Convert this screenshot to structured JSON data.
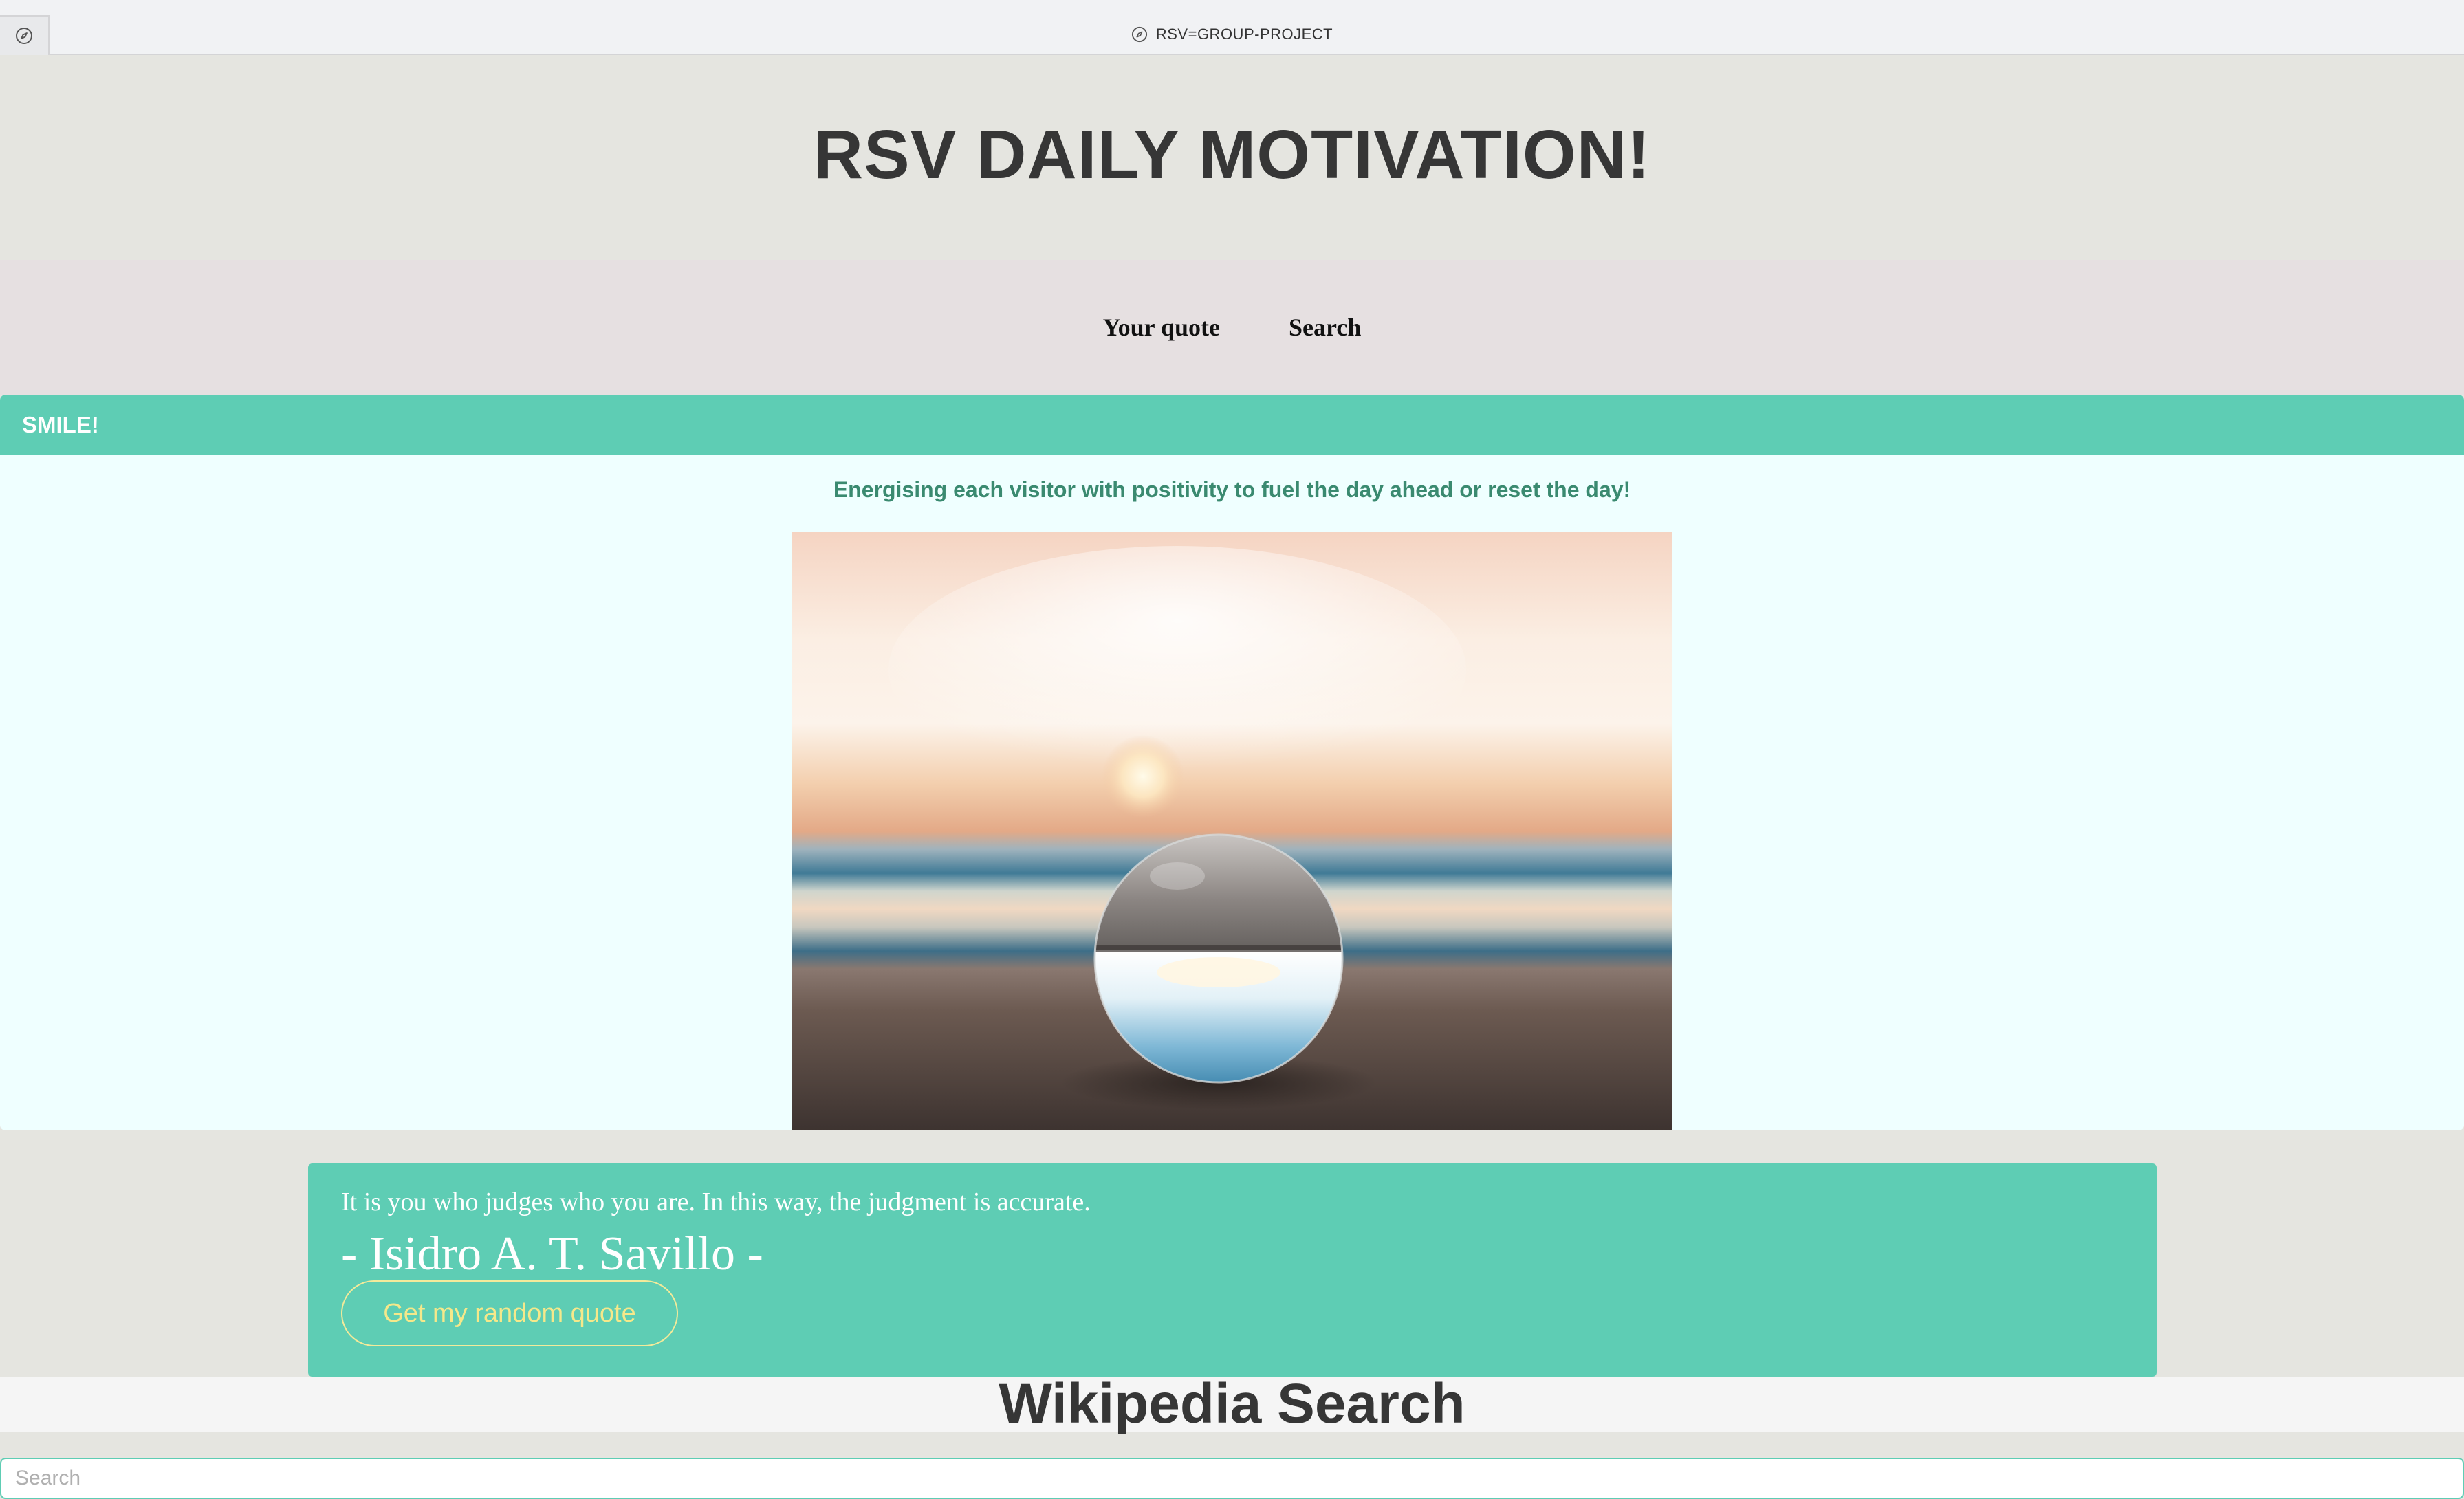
{
  "browser": {
    "tab_title": "RSV=GROUP-PROJECT"
  },
  "header": {
    "title": "RSV DAILY MOTIVATION!"
  },
  "nav": {
    "items": [
      {
        "label": "Your quote"
      },
      {
        "label": "Search"
      }
    ]
  },
  "card": {
    "header": "SMILE!",
    "tagline": "Energising each visitor with positivity to fuel the day ahead or reset the day!",
    "image_description_icon": "sunset-beach-crystal-ball-photo"
  },
  "quote": {
    "text": "It is you who judges who you are. In this way, the judgment is accurate.",
    "author": "- Isidro A. T. Savillo -",
    "button_label": "Get my random quote"
  },
  "wiki": {
    "title": "Wikipedia Search",
    "search_placeholder": "Search"
  },
  "colors": {
    "accent": "#5ecdb4",
    "button_text": "#f5e88a",
    "tagline": "#3a8a70"
  }
}
